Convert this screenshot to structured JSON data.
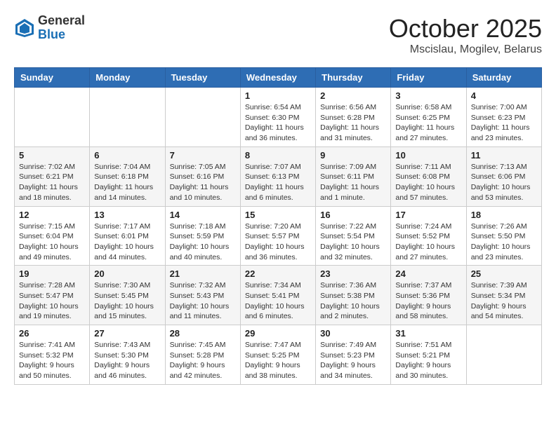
{
  "header": {
    "logo_general": "General",
    "logo_blue": "Blue",
    "month_title": "October 2025",
    "location": "Mscislau, Mogilev, Belarus"
  },
  "days_of_week": [
    "Sunday",
    "Monday",
    "Tuesday",
    "Wednesday",
    "Thursday",
    "Friday",
    "Saturday"
  ],
  "weeks": [
    [
      {
        "day": "",
        "info": ""
      },
      {
        "day": "",
        "info": ""
      },
      {
        "day": "",
        "info": ""
      },
      {
        "day": "1",
        "info": "Sunrise: 6:54 AM\nSunset: 6:30 PM\nDaylight: 11 hours\nand 36 minutes."
      },
      {
        "day": "2",
        "info": "Sunrise: 6:56 AM\nSunset: 6:28 PM\nDaylight: 11 hours\nand 31 minutes."
      },
      {
        "day": "3",
        "info": "Sunrise: 6:58 AM\nSunset: 6:25 PM\nDaylight: 11 hours\nand 27 minutes."
      },
      {
        "day": "4",
        "info": "Sunrise: 7:00 AM\nSunset: 6:23 PM\nDaylight: 11 hours\nand 23 minutes."
      }
    ],
    [
      {
        "day": "5",
        "info": "Sunrise: 7:02 AM\nSunset: 6:21 PM\nDaylight: 11 hours\nand 18 minutes."
      },
      {
        "day": "6",
        "info": "Sunrise: 7:04 AM\nSunset: 6:18 PM\nDaylight: 11 hours\nand 14 minutes."
      },
      {
        "day": "7",
        "info": "Sunrise: 7:05 AM\nSunset: 6:16 PM\nDaylight: 11 hours\nand 10 minutes."
      },
      {
        "day": "8",
        "info": "Sunrise: 7:07 AM\nSunset: 6:13 PM\nDaylight: 11 hours\nand 6 minutes."
      },
      {
        "day": "9",
        "info": "Sunrise: 7:09 AM\nSunset: 6:11 PM\nDaylight: 11 hours\nand 1 minute."
      },
      {
        "day": "10",
        "info": "Sunrise: 7:11 AM\nSunset: 6:08 PM\nDaylight: 10 hours\nand 57 minutes."
      },
      {
        "day": "11",
        "info": "Sunrise: 7:13 AM\nSunset: 6:06 PM\nDaylight: 10 hours\nand 53 minutes."
      }
    ],
    [
      {
        "day": "12",
        "info": "Sunrise: 7:15 AM\nSunset: 6:04 PM\nDaylight: 10 hours\nand 49 minutes."
      },
      {
        "day": "13",
        "info": "Sunrise: 7:17 AM\nSunset: 6:01 PM\nDaylight: 10 hours\nand 44 minutes."
      },
      {
        "day": "14",
        "info": "Sunrise: 7:18 AM\nSunset: 5:59 PM\nDaylight: 10 hours\nand 40 minutes."
      },
      {
        "day": "15",
        "info": "Sunrise: 7:20 AM\nSunset: 5:57 PM\nDaylight: 10 hours\nand 36 minutes."
      },
      {
        "day": "16",
        "info": "Sunrise: 7:22 AM\nSunset: 5:54 PM\nDaylight: 10 hours\nand 32 minutes."
      },
      {
        "day": "17",
        "info": "Sunrise: 7:24 AM\nSunset: 5:52 PM\nDaylight: 10 hours\nand 27 minutes."
      },
      {
        "day": "18",
        "info": "Sunrise: 7:26 AM\nSunset: 5:50 PM\nDaylight: 10 hours\nand 23 minutes."
      }
    ],
    [
      {
        "day": "19",
        "info": "Sunrise: 7:28 AM\nSunset: 5:47 PM\nDaylight: 10 hours\nand 19 minutes."
      },
      {
        "day": "20",
        "info": "Sunrise: 7:30 AM\nSunset: 5:45 PM\nDaylight: 10 hours\nand 15 minutes."
      },
      {
        "day": "21",
        "info": "Sunrise: 7:32 AM\nSunset: 5:43 PM\nDaylight: 10 hours\nand 11 minutes."
      },
      {
        "day": "22",
        "info": "Sunrise: 7:34 AM\nSunset: 5:41 PM\nDaylight: 10 hours\nand 6 minutes."
      },
      {
        "day": "23",
        "info": "Sunrise: 7:36 AM\nSunset: 5:38 PM\nDaylight: 10 hours\nand 2 minutes."
      },
      {
        "day": "24",
        "info": "Sunrise: 7:37 AM\nSunset: 5:36 PM\nDaylight: 9 hours\nand 58 minutes."
      },
      {
        "day": "25",
        "info": "Sunrise: 7:39 AM\nSunset: 5:34 PM\nDaylight: 9 hours\nand 54 minutes."
      }
    ],
    [
      {
        "day": "26",
        "info": "Sunrise: 7:41 AM\nSunset: 5:32 PM\nDaylight: 9 hours\nand 50 minutes."
      },
      {
        "day": "27",
        "info": "Sunrise: 7:43 AM\nSunset: 5:30 PM\nDaylight: 9 hours\nand 46 minutes."
      },
      {
        "day": "28",
        "info": "Sunrise: 7:45 AM\nSunset: 5:28 PM\nDaylight: 9 hours\nand 42 minutes."
      },
      {
        "day": "29",
        "info": "Sunrise: 7:47 AM\nSunset: 5:25 PM\nDaylight: 9 hours\nand 38 minutes."
      },
      {
        "day": "30",
        "info": "Sunrise: 7:49 AM\nSunset: 5:23 PM\nDaylight: 9 hours\nand 34 minutes."
      },
      {
        "day": "31",
        "info": "Sunrise: 7:51 AM\nSunset: 5:21 PM\nDaylight: 9 hours\nand 30 minutes."
      },
      {
        "day": "",
        "info": ""
      }
    ]
  ]
}
